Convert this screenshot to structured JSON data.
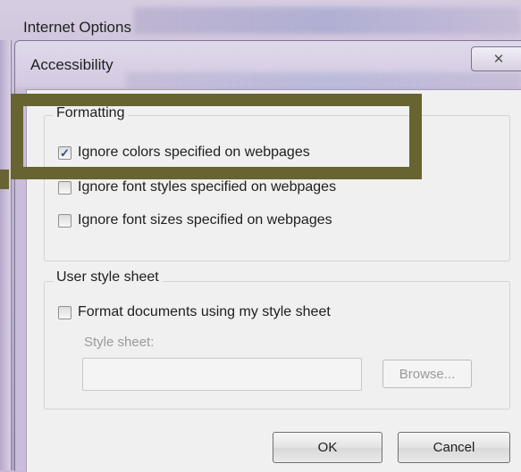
{
  "parent_window": {
    "title": "Internet Options"
  },
  "dialog": {
    "title": "Accessibility",
    "close_symbol": "✕"
  },
  "formatting": {
    "group_label": "Formatting",
    "options": [
      {
        "label": "Ignore colors specified on webpages",
        "checked": true
      },
      {
        "label": "Ignore font styles specified on webpages",
        "checked": false
      },
      {
        "label": "Ignore font sizes specified on webpages",
        "checked": false
      }
    ]
  },
  "user_style_sheet": {
    "group_label": "User style sheet",
    "format_option": {
      "label": "Format documents using my style sheet",
      "checked": false
    },
    "style_sheet_label": "Style sheet:",
    "style_sheet_value": "",
    "browse_label": "Browse..."
  },
  "buttons": {
    "ok": "OK",
    "cancel": "Cancel"
  },
  "colors": {
    "highlight": "#676431",
    "check": "#2c4a8c"
  }
}
